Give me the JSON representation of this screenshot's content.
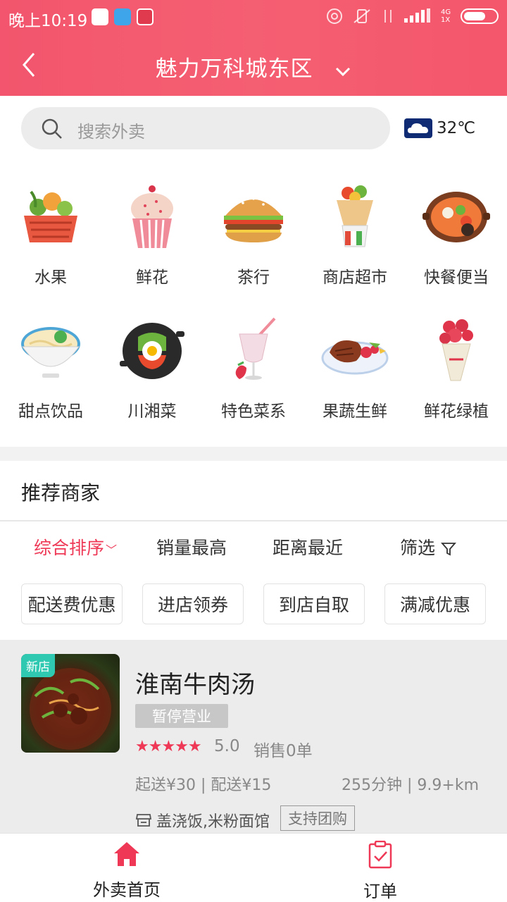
{
  "status_bar": {
    "time": "晚上10:19",
    "network": "4G 1X"
  },
  "header": {
    "location": "魅力万科城东区"
  },
  "search": {
    "placeholder": "搜索外卖"
  },
  "weather": {
    "temp": "32℃"
  },
  "categories": [
    {
      "label": "水果",
      "icon": "fruit-basket-icon"
    },
    {
      "label": "鲜花",
      "icon": "cupcake-icon"
    },
    {
      "label": "茶行",
      "icon": "burger-icon"
    },
    {
      "label": "商店超市",
      "icon": "wrap-icon"
    },
    {
      "label": "快餐便当",
      "icon": "hotpot-icon"
    },
    {
      "label": "甜点饮品",
      "icon": "noodle-bowl-icon"
    },
    {
      "label": "川湘菜",
      "icon": "bibimbap-icon"
    },
    {
      "label": "特色菜系",
      "icon": "smoothie-icon"
    },
    {
      "label": "果蔬生鲜",
      "icon": "steak-plate-icon"
    },
    {
      "label": "鲜花绿植",
      "icon": "bouquet-icon"
    }
  ],
  "section": {
    "title": "推荐商家"
  },
  "sort_tabs": [
    {
      "label": "综合排序",
      "active": true
    },
    {
      "label": "销量最高"
    },
    {
      "label": "距离最近"
    },
    {
      "label": "筛选"
    }
  ],
  "filters": [
    "配送费优惠",
    "进店领券",
    "到店自取",
    "满减优惠"
  ],
  "shop": {
    "badge": "新店",
    "name": "淮南牛肉汤",
    "status": "暂停营业",
    "stars": "★★★★★",
    "rating": "5.0",
    "sales": "销售0单",
    "fee": "起送¥30 | 配送¥15",
    "eta": "255分钟 | 9.9+km",
    "category": "盖浇饭,米粉面馆",
    "group": "支持团购"
  },
  "tabbar": {
    "home": "外卖首页",
    "orders": "订单"
  },
  "colors": {
    "accent": "#ee3856",
    "header": "#f4566b",
    "badge": "#2ec9b0"
  }
}
